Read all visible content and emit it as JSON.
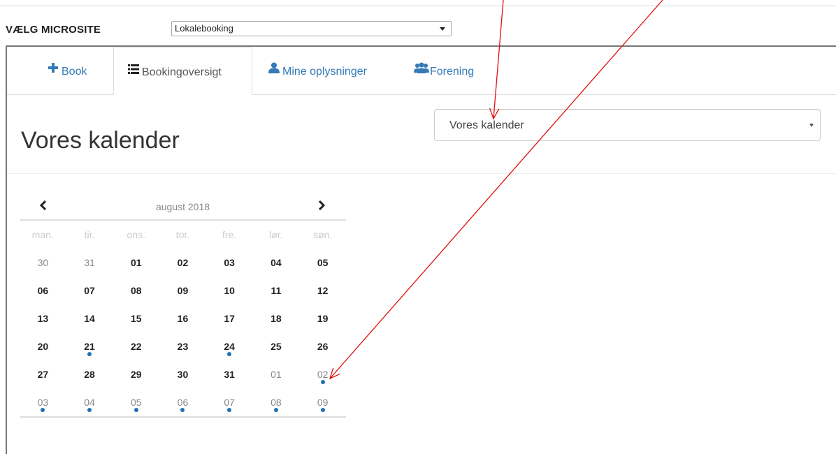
{
  "site": {
    "label": "VÆLG MICROSITE",
    "selected": "Lokalebooking"
  },
  "tabs": [
    {
      "label": "Book",
      "icon": "plus-icon"
    },
    {
      "label": "Bookingoversigt",
      "icon": "list-icon"
    },
    {
      "label": "Mine oplysninger",
      "icon": "user-icon"
    },
    {
      "label": "Forening",
      "icon": "users-icon"
    }
  ],
  "page": {
    "title": "Vores kalender"
  },
  "calendar_select": {
    "selected": "Vores kalender"
  },
  "calendar": {
    "month": "august 2018",
    "prev": "‹",
    "next": "›",
    "weekdays": [
      "man.",
      "tir.",
      "ons.",
      "tor.",
      "fre.",
      "lør.",
      "søn."
    ],
    "weeks": [
      [
        {
          "d": "30",
          "other": true
        },
        {
          "d": "31",
          "other": true
        },
        {
          "d": "01"
        },
        {
          "d": "02"
        },
        {
          "d": "03"
        },
        {
          "d": "04"
        },
        {
          "d": "05"
        }
      ],
      [
        {
          "d": "06"
        },
        {
          "d": "07"
        },
        {
          "d": "08"
        },
        {
          "d": "09"
        },
        {
          "d": "10"
        },
        {
          "d": "11"
        },
        {
          "d": "12"
        }
      ],
      [
        {
          "d": "13"
        },
        {
          "d": "14"
        },
        {
          "d": "15"
        },
        {
          "d": "16"
        },
        {
          "d": "17"
        },
        {
          "d": "18"
        },
        {
          "d": "19"
        }
      ],
      [
        {
          "d": "20"
        },
        {
          "d": "21",
          "event": true
        },
        {
          "d": "22"
        },
        {
          "d": "23"
        },
        {
          "d": "24",
          "event": true
        },
        {
          "d": "25"
        },
        {
          "d": "26"
        }
      ],
      [
        {
          "d": "27"
        },
        {
          "d": "28"
        },
        {
          "d": "29"
        },
        {
          "d": "30"
        },
        {
          "d": "31"
        },
        {
          "d": "01",
          "other": true
        },
        {
          "d": "02",
          "other": true,
          "event": true
        }
      ],
      [
        {
          "d": "03",
          "other": true,
          "event": true
        },
        {
          "d": "04",
          "other": true,
          "event": true
        },
        {
          "d": "05",
          "other": true,
          "event": true
        },
        {
          "d": "06",
          "other": true,
          "event": true
        },
        {
          "d": "07",
          "other": true,
          "event": true
        },
        {
          "d": "08",
          "other": true,
          "event": true
        },
        {
          "d": "09",
          "other": true,
          "event": true
        }
      ]
    ]
  },
  "colors": {
    "link": "#337ab7",
    "event_dot": "#1f6fb5",
    "annotation_arrow": "#e01010"
  }
}
